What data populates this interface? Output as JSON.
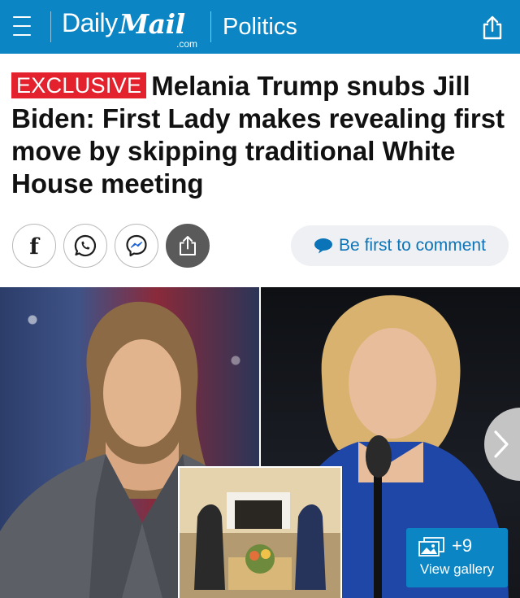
{
  "header": {
    "brand_daily": "Daily",
    "brand_mail": "Mail",
    "brand_com": ".com",
    "section": "Politics",
    "menu_icon": "hamburger-menu-icon",
    "share_icon": "share-icon",
    "background_color": "#0b85c4"
  },
  "article": {
    "badge": "EXCLUSIVE",
    "badge_color": "#e3222e",
    "headline": "Melania Trump snubs Jill Biden: First Lady makes revealing first move by skipping traditional White House meeting"
  },
  "social": {
    "buttons": [
      "facebook-icon",
      "whatsapp-icon",
      "messenger-icon",
      "share-icon"
    ],
    "comment_label": "Be first to comment",
    "comment_icon": "speech-bubble-icon",
    "link_color": "#0b74b8"
  },
  "gallery": {
    "count": "+9",
    "label": "View gallery",
    "icon": "photo-stack-icon",
    "next_icon": "chevron-right-icon"
  }
}
